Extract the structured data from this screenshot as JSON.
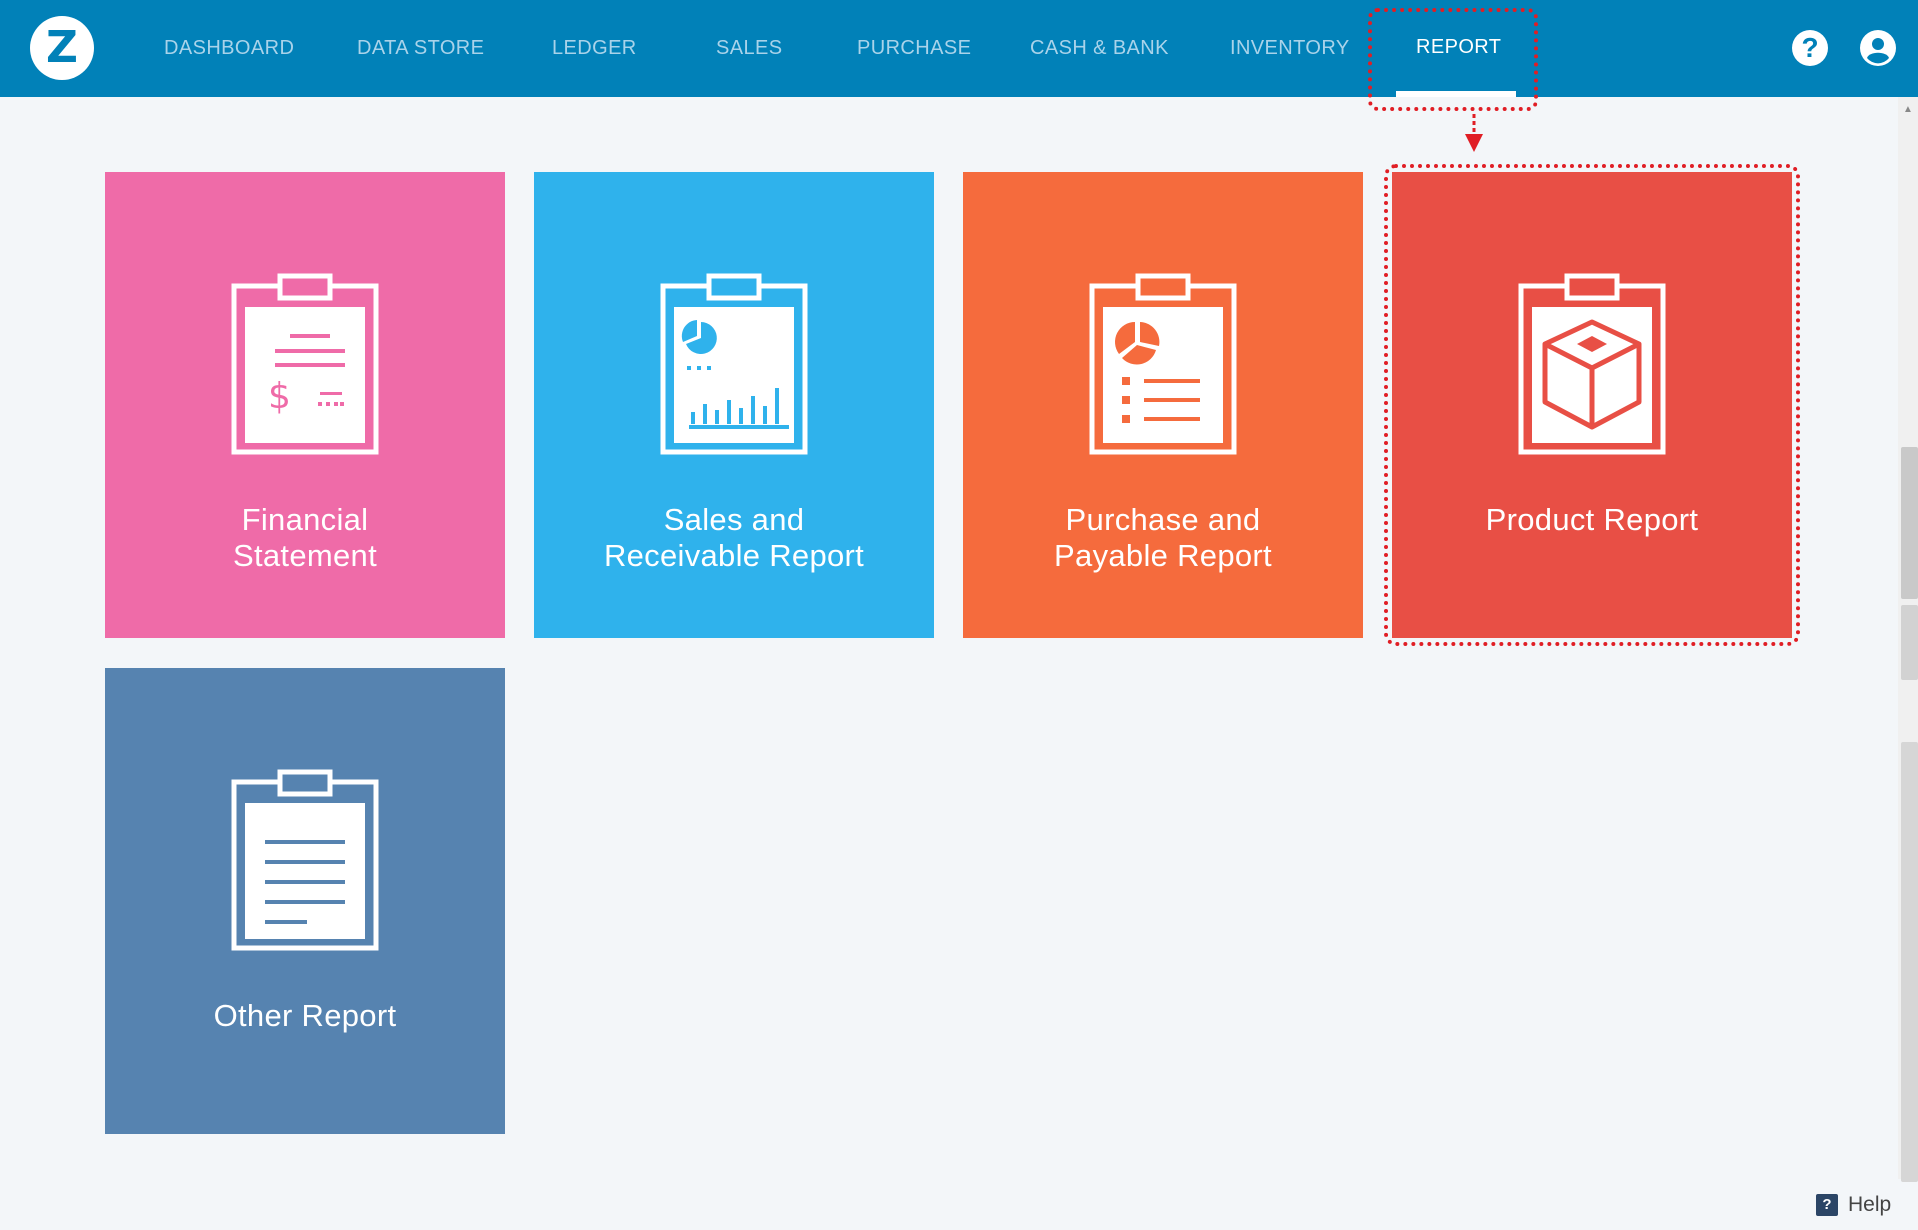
{
  "app": {
    "logo_letter": "Z"
  },
  "nav": {
    "items": [
      {
        "label": "DASHBOARD"
      },
      {
        "label": "DATA STORE"
      },
      {
        "label": "LEDGER"
      },
      {
        "label": "SALES"
      },
      {
        "label": "PURCHASE"
      },
      {
        "label": "CASH & BANK"
      },
      {
        "label": "INVENTORY"
      },
      {
        "label": "REPORT",
        "active": true
      }
    ]
  },
  "header_icons": {
    "help_glyph": "?",
    "help": "help-circle-icon",
    "user": "user-account-icon"
  },
  "tiles": [
    {
      "line1": "Financial",
      "line2": "Statement",
      "color": "#ef6ba8",
      "icon": "financial-statement-icon"
    },
    {
      "line1": "Sales and",
      "line2": "Receivable Report",
      "color": "#2fb2ec",
      "icon": "sales-receivable-icon"
    },
    {
      "line1": "Purchase and",
      "line2": "Payable Report",
      "color": "#f56b3d",
      "icon": "purchase-payable-icon"
    },
    {
      "line1": "Product Report",
      "line2": "",
      "color": "#e84f45",
      "icon": "product-box-icon"
    },
    {
      "line1": "Other Report",
      "line2": "",
      "color": "#5683b0",
      "icon": "other-report-icon"
    }
  ],
  "footer": {
    "help_glyph": "?",
    "help_label": "Help"
  },
  "annotation_color": "#e01e25"
}
